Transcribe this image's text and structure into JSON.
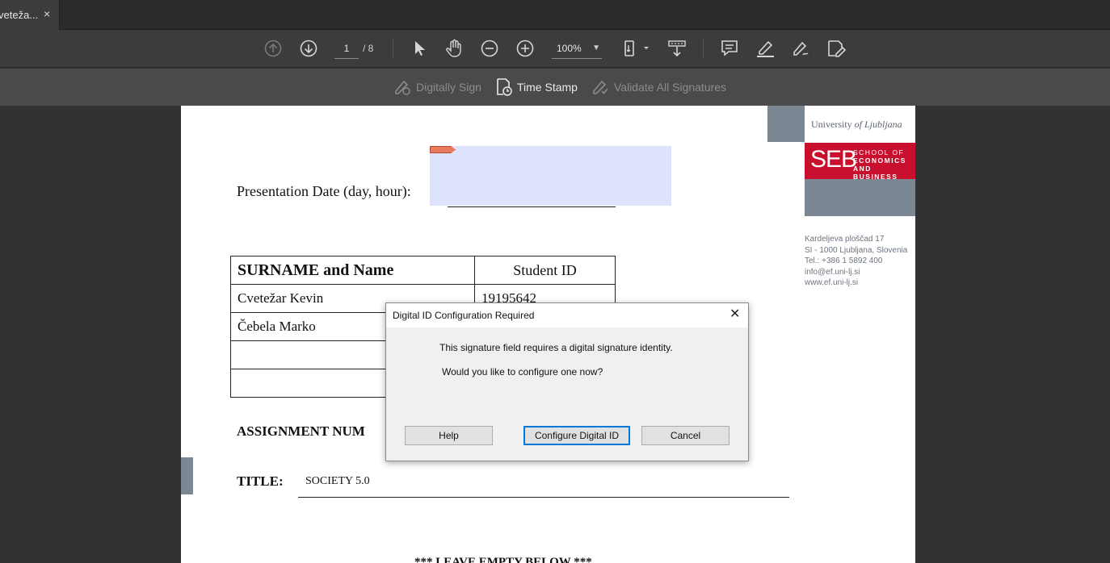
{
  "tab": {
    "title": "veteža...",
    "close": "×"
  },
  "toolbar": {
    "page_current": "1",
    "page_total": "/ 8",
    "zoom": "100%"
  },
  "sign_toolbar": {
    "digitally_sign": "Digitally Sign",
    "time_stamp": "Time Stamp",
    "validate_all": "Validate All Signatures"
  },
  "document": {
    "university": {
      "name_plain": "University ",
      "name_italic": "of Ljubljana"
    },
    "logo": {
      "abbr": "SEB",
      "line1": "SCHOOL OF",
      "line2": "ECONOMICS",
      "line3": "AND BUSINESS"
    },
    "address": [
      "Kardeljeva ploščad 17",
      "SI - 1000 Ljubljana, Slovenia",
      "Tel.: +386 1 5892 400",
      "info@ef.uni-lj.si",
      "www.ef.uni-lj.si"
    ],
    "presentation_label": "Presentation Date (day, hour):",
    "table": {
      "headers": [
        "SURNAME and Name",
        "Student ID"
      ],
      "rows": [
        [
          "Cvetežar Kevin",
          "19195642"
        ],
        [
          "Čebela Marko",
          ""
        ],
        [
          "",
          ""
        ],
        [
          "",
          ""
        ]
      ]
    },
    "assignment_label": "ASSIGNMENT NUM",
    "title_label": "TITLE:",
    "title_value": "SOCIETY 5.0",
    "leave_empty": "*** LEAVE EMPTY BELOW ***"
  },
  "dialog": {
    "title": "Digital ID Configuration Required",
    "close": "✕",
    "message1": "This signature field requires a digital signature identity.",
    "message2": "Would you like to configure one now?",
    "help": "Help",
    "configure": "Configure Digital ID",
    "cancel": "Cancel"
  },
  "colors": {
    "seb_red": "#c8102e",
    "logo_gray": "#7b8793",
    "sig_field": "#dde3fb",
    "focus_blue": "#0078d7"
  }
}
